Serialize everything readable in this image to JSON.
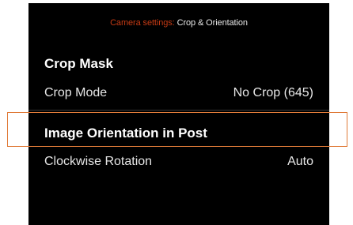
{
  "header": {
    "prefix": "Camera settings:",
    "title": "Crop & Orientation"
  },
  "sections": {
    "crop_mask": {
      "title": "Crop Mask",
      "crop_mode_label": "Crop Mode",
      "crop_mode_value": "No Crop (645)"
    },
    "image_orientation": {
      "title": "Image Orientation in Post",
      "rotation_label": "Clockwise Rotation",
      "rotation_value": "Auto"
    }
  },
  "colors": {
    "highlight": "#e07b39",
    "header_prefix": "#c43a14",
    "background": "#000000"
  }
}
